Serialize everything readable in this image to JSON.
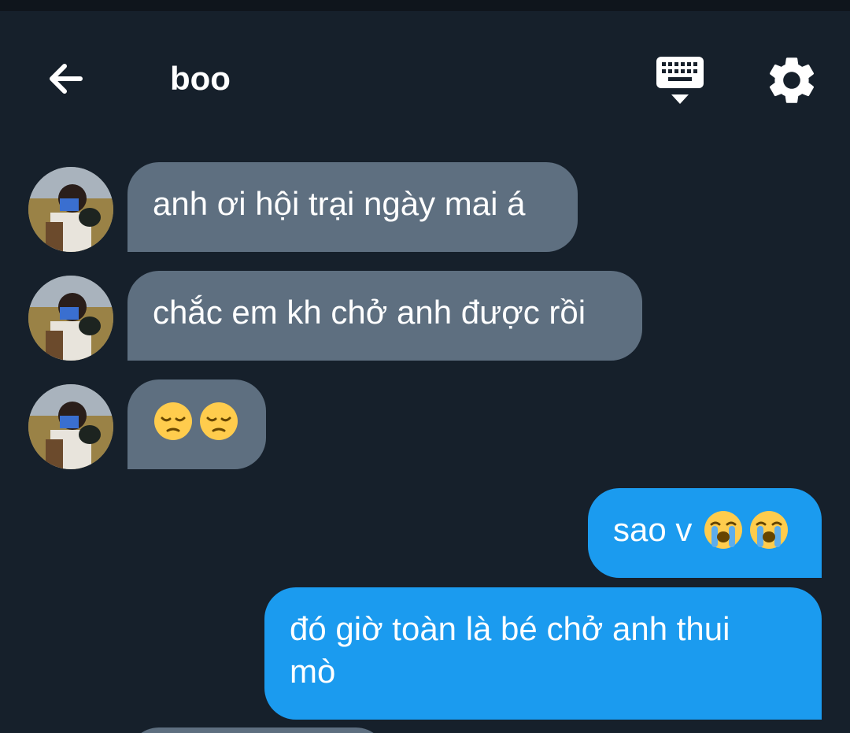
{
  "header": {
    "title": "boo",
    "back_icon": "back-arrow-icon",
    "keyboard_icon": "keyboard-icon",
    "settings_icon": "gear-icon"
  },
  "messages": [
    {
      "direction": "in",
      "text": "anh ơi hội trại ngày mai á"
    },
    {
      "direction": "in",
      "text": "chắc em kh chở anh được rồi"
    },
    {
      "direction": "in",
      "emojis": [
        "pensive-face",
        "pensive-face"
      ]
    },
    {
      "direction": "out",
      "text": "sao v",
      "emojis": [
        "loudly-crying-face",
        "loudly-crying-face"
      ]
    },
    {
      "direction": "out",
      "text_line1": "đó giờ toàn là bé chở anh thui",
      "text_line2": "mò"
    }
  ],
  "colors": {
    "background": "#16202b",
    "incoming_bubble": "#5e6f80",
    "outgoing_bubble": "#1b9bef",
    "text": "#ffffff"
  }
}
